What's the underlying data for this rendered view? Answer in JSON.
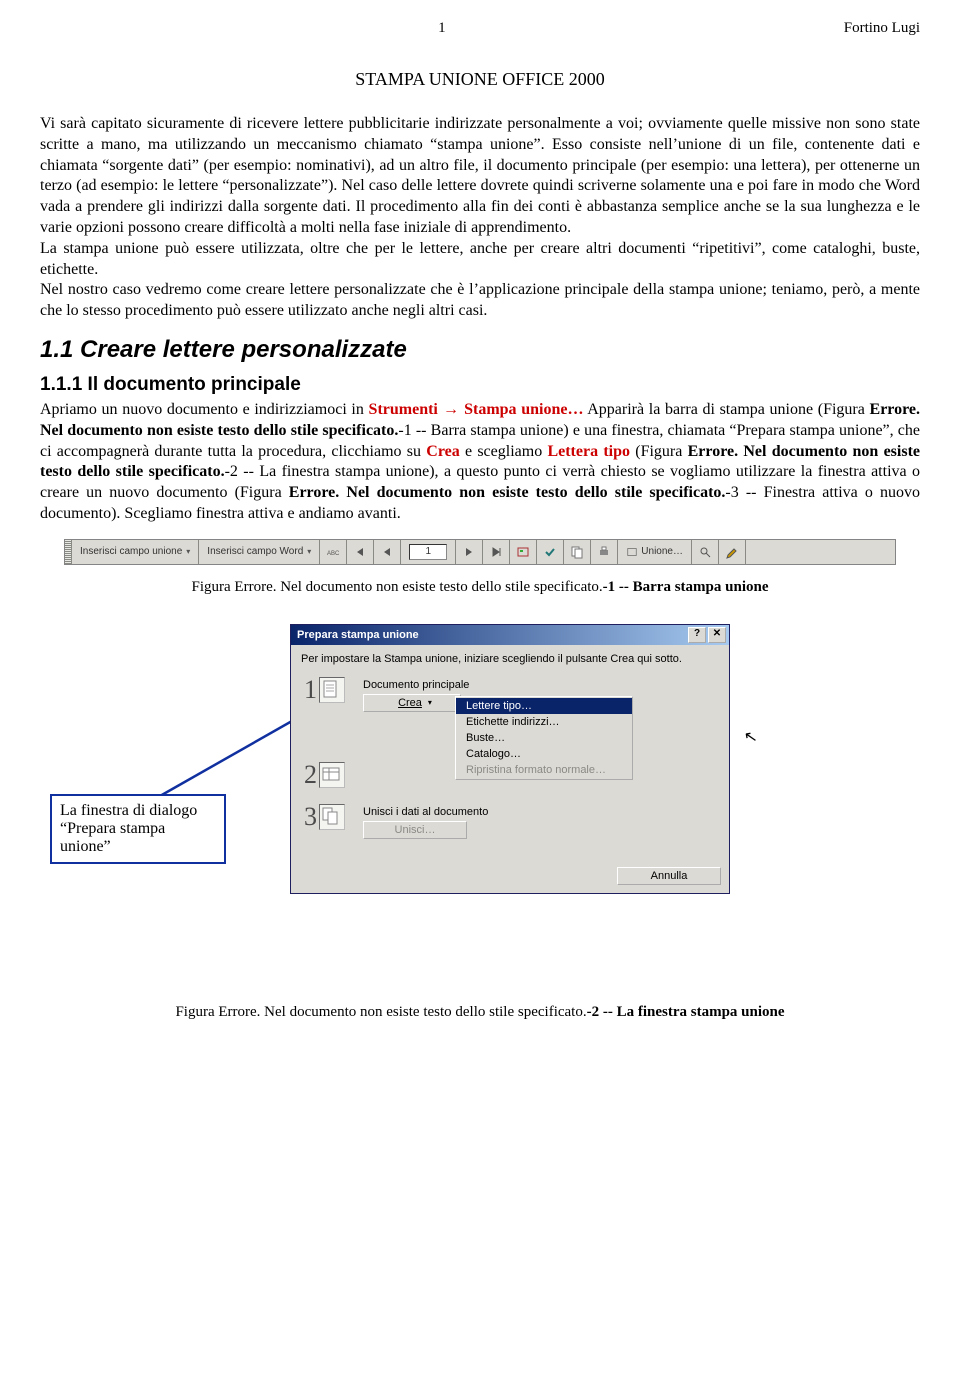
{
  "header": {
    "page_number": "1",
    "author": "Fortino Lugi"
  },
  "title": "STAMPA UNIONE OFFICE 2000",
  "paragraphs": {
    "p1_a": "Vi sarà capitato sicuramente di ricevere lettere pubblicitarie indirizzate  personalmente a voi; ovviamente quelle missive non sono state scritte a mano, ma utilizzando un meccanismo chiamato “stampa unione”. Esso consiste nell’unione di un file, contenente dati e chiamata “sorgente dati” (per esempio: nominativi), ad un altro file, il documento principale (per esempio: una lettera), per ottenerne un terzo (ad esempio: le lettere “personalizzate”). Nel caso delle lettere dovrete quindi scriverne solamente una e poi fare in modo che Word vada a prendere gli indirizzi dalla sorgente dati. Il procedimento alla fin dei conti è abbastanza semplice anche se la sua lunghezza e le varie opzioni possono creare difficoltà a molti nella fase iniziale di apprendimento.",
    "p1_b": "La stampa unione può essere utilizzata, oltre che per le lettere, anche per creare altri documenti “ripetitivi”, come cataloghi, buste, etichette.",
    "p1_c": "Nel nostro caso vedremo come creare lettere personalizzate che è l’applicazione principale della stampa unione; teniamo, però, a mente che lo stesso procedimento può essere utilizzato anche negli altri casi."
  },
  "h2": "1.1  Creare lettere personalizzate",
  "h3": "1.1.1  Il documento principale",
  "sec": {
    "a": "Apriamo un nuovo documento e indirizziamoci in ",
    "strumenti": "Strumenti",
    "arrow": " → ",
    "stampa": "Stampa unione…",
    "b": " Apparirà la barra di stampa unione (Figura ",
    "err": "Errore. Nel documento non esiste testo dello stile specificato.",
    "c": "-1 -- Barra stampa unione) e una finestra, chiamata “Prepara stampa unione”, che ci accompagnerà durante tutta la procedura, clicchiamo su ",
    "crea": "Crea",
    "d": " e scegliamo ",
    "lettera": "Lettera tipo",
    "e": " (Figura ",
    "f": "-2 -- La finestra stampa unione), a questo punto ci verrà chiesto se vogliamo utilizzare la finestra attiva o creare un nuovo documento (Figura ",
    "g": "-3 -- Finestra attiva o nuovo documento). Scegliamo finestra attiva e andiamo avanti."
  },
  "caption1": {
    "a": "Figura ",
    "b": "Errore. Nel documento non esiste testo dello stile specificato.",
    "c": "-1 -- Barra stampa unione"
  },
  "toolbar": {
    "btn1": "Inserisci campo unione",
    "btn2": "Inserisci campo Word",
    "field": "1",
    "unione": "Unione…"
  },
  "callout": "La finestra di dialogo “Prepara stampa unione”",
  "dialog": {
    "title": "Prepara stampa unione",
    "instr": "Per impostare la Stampa unione, iniziare scegliendo il pulsante Crea qui sotto.",
    "step1_label": "Documento principale",
    "step1_btn": "Crea",
    "menu": {
      "m1": "Lettere tipo…",
      "m2": "Etichette indirizzi…",
      "m3": "Buste…",
      "m4": "Catalogo…",
      "m5": "Ripristina formato normale…"
    },
    "step3_label": "Unisci i dati al documento",
    "step3_btn": "Unisci…",
    "cancel": "Annulla"
  },
  "steps": {
    "n1": "1",
    "n2": "2",
    "n3": "3"
  },
  "caption2": {
    "a": "Figura ",
    "b": "Errore. Nel documento non esiste testo dello stile specificato.",
    "c": "-2 -- La finestra stampa unione"
  }
}
